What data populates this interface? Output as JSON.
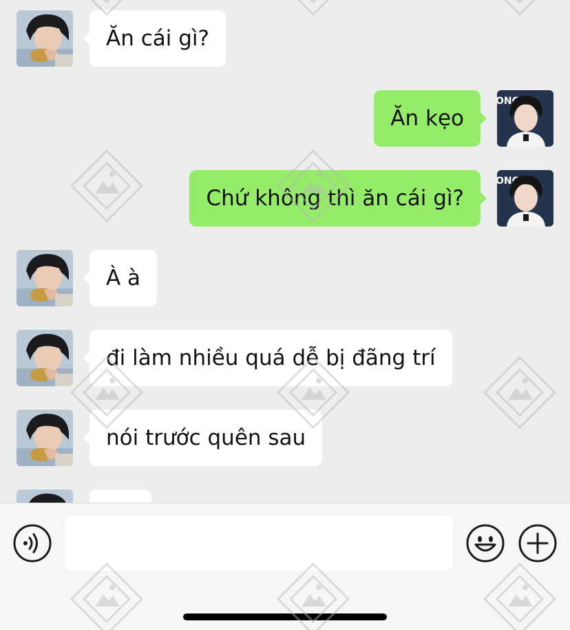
{
  "messages": [
    {
      "side": "in",
      "text": "Ăn cái gì?"
    },
    {
      "side": "out",
      "text": "Ăn kẹo"
    },
    {
      "side": "out",
      "text": "Chứ không thì ăn cái gì?"
    },
    {
      "side": "in",
      "text": "À à"
    },
    {
      "side": "in",
      "text": "đi làm nhiều quá dễ bị đãng trí"
    },
    {
      "side": "in",
      "text": "nói trước quên sau"
    },
    {
      "side": "in",
      "text": ""
    }
  ],
  "input": {
    "value": "",
    "placeholder": ""
  },
  "icons": {
    "voice": "voice-icon",
    "emoji": "emoji-icon",
    "plus": "plus-icon"
  },
  "colors": {
    "background": "#ededed",
    "incoming_bubble": "#ffffff",
    "outgoing_bubble": "#95ec69"
  }
}
